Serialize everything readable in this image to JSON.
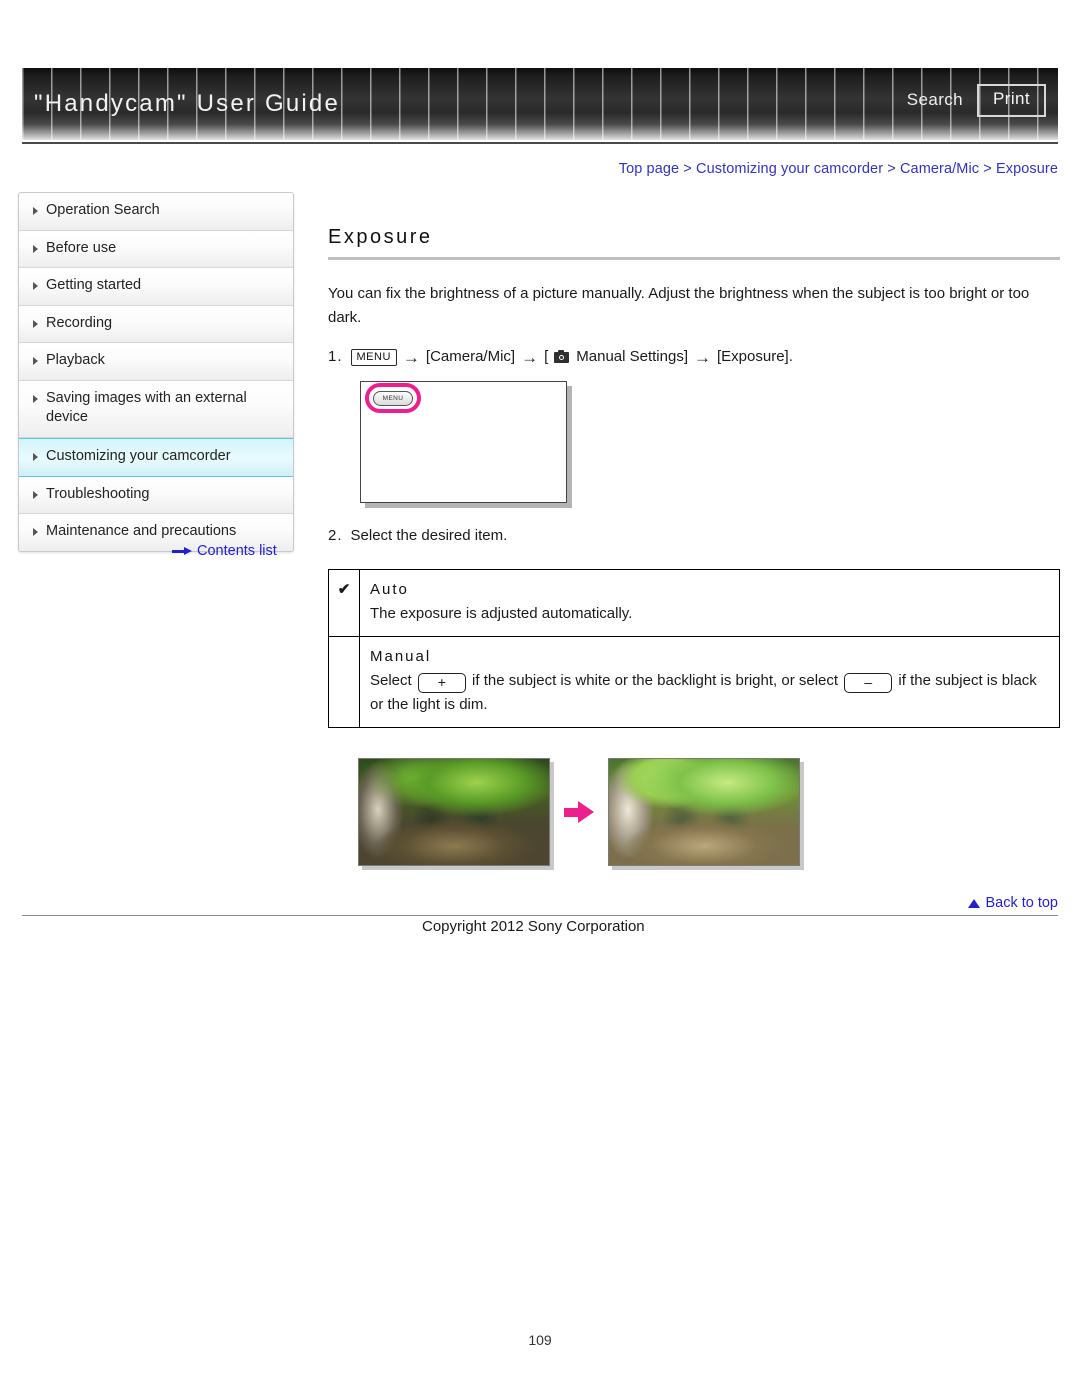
{
  "header": {
    "title": "\"Handycam\" User Guide",
    "search_label": "Search",
    "print_label": "Print"
  },
  "breadcrumb": {
    "text": "Top page > Customizing your camcorder > Camera/Mic > Exposure"
  },
  "sidebar": {
    "items": [
      {
        "label": "Operation Search",
        "active": false
      },
      {
        "label": "Before use",
        "active": false
      },
      {
        "label": "Getting started",
        "active": false
      },
      {
        "label": "Recording",
        "active": false
      },
      {
        "label": "Playback",
        "active": false
      },
      {
        "label": "Saving images with an external device",
        "active": false
      },
      {
        "label": "Customizing your camcorder",
        "active": true
      },
      {
        "label": "Troubleshooting",
        "active": false
      },
      {
        "label": "Maintenance and precautions",
        "active": false
      }
    ],
    "contents_link": "Contents list"
  },
  "main": {
    "title": "Exposure",
    "intro": "You can fix the brightness of a picture manually. Adjust the brightness when the subject is too bright or too dark.",
    "step1": {
      "number": "1.",
      "menu_chip": "MENU",
      "arrow": "→",
      "part_camera_mic": "[Camera/Mic]",
      "part_manual_open": "[",
      "part_manual_settings": "Manual Settings]",
      "part_exposure": "[Exposure]."
    },
    "lcd": {
      "menu_button_label": "MENU"
    },
    "step2": {
      "number": "2.",
      "text": "Select the desired item."
    },
    "options": [
      {
        "checked": "✔",
        "name": "Auto",
        "description": "The exposure is adjusted automatically."
      },
      {
        "checked": "",
        "name": "Manual",
        "desc_part1": "Select",
        "plus_chip": "+",
        "desc_part2": "if the subject is white or the backlight is bright, or select",
        "minus_chip": "–",
        "desc_part3": "if the subject is black or the light is dim."
      }
    ]
  },
  "footer": {
    "back_to_top": "Back to top",
    "copyright": "Copyright 2012 Sony Corporation",
    "page_number": "109"
  }
}
